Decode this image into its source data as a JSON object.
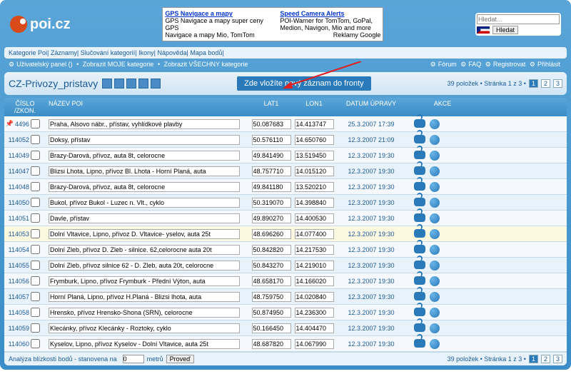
{
  "site": {
    "name": "poi.cz"
  },
  "ads": {
    "col1": {
      "title": "GPS Navigace a mapy",
      "line1": "GPS Navigace a mapy super ceny GPS",
      "line2": "Navigace a mapy Mio, TomTom"
    },
    "col2": {
      "title": "Speed Camera Alerts",
      "line1": "POI-Warner for TomTom, GoPal,",
      "line2": "Medion, Navigon, Mio and more",
      "foot": "Reklamy Google"
    }
  },
  "search": {
    "placeholder": "Hledat...",
    "button": "Hledat"
  },
  "nav": {
    "items": [
      "Kategorie Poi",
      "Záznamy",
      "Slučování kategorií",
      "Ikony",
      "Nápověda",
      "Mapa bodů"
    ]
  },
  "subnav": {
    "left": [
      "Uživatelský panel ()",
      "Zobrazit MOJE kategorie",
      "Zobrazit VŠECHNY kategorie"
    ],
    "right": [
      "Fórum",
      "FAQ",
      "Registrovat",
      "Přihlásit"
    ]
  },
  "title": "CZ-Privozy_pristavy",
  "banner": "Zde vložíte nový záznam do fronty",
  "pager": {
    "text": "39 položek • Stránka 1 z 3 •",
    "pages": [
      "1",
      "2",
      "3"
    ]
  },
  "columns": {
    "c1": "ČÍSLO /ZKON.",
    "c2": "NÁZEV POI",
    "c3": "LAT1",
    "c4": "LON1",
    "c5": "DATUM ÚPRAVY",
    "c6": "AKCE"
  },
  "rows": [
    {
      "id": "4496",
      "pin": true,
      "name": "Praha, Alsovo nábr., přístav, vyhlídkové plavby",
      "lat": "50.087683",
      "lon": "14.413747",
      "date": "25.3.2007 17:39"
    },
    {
      "id": "114052",
      "name": "Doksy, přístav",
      "lat": "50.576110",
      "lon": "14.650760",
      "date": "12.3.2007 21:09"
    },
    {
      "id": "114049",
      "name": "Brazy-Darová, přívoz, auta 8t, celorocne",
      "lat": "49.841490",
      "lon": "13.519450",
      "date": "12.3.2007 19:30"
    },
    {
      "id": "114047",
      "name": "Blizsi Lhota, Lipno, přívoz Bl. Lhota - Horní Planá, auta",
      "lat": "48.757710",
      "lon": "14.015120",
      "date": "12.3.2007 19:30"
    },
    {
      "id": "114048",
      "name": "Brazy-Darová, přívoz, auta 8t, celorocne",
      "lat": "49.841180",
      "lon": "13.520210",
      "date": "12.3.2007 19:30"
    },
    {
      "id": "114050",
      "name": "Bukol, přívoz Bukol - Luzec n. Vlt., cyklo",
      "lat": "50.319070",
      "lon": "14.398840",
      "date": "12.3.2007 19:30"
    },
    {
      "id": "114051",
      "name": "Davle, přístav",
      "lat": "49.890270",
      "lon": "14.400530",
      "date": "12.3.2007 19:30"
    },
    {
      "id": "114053",
      "hl": true,
      "name": "Dolní Vltavice, Lipno, přívoz D. Vltavice- yselov, auta 25t",
      "lat": "48.696260",
      "lon": "14.077400",
      "date": "12.3.2007 19:30"
    },
    {
      "id": "114054",
      "name": "Dolní Zleb, přívoz D. Zleb - silnice. 62,celorocne auta 20t",
      "lat": "50.842820",
      "lon": "14.217530",
      "date": "12.3.2007 19:30"
    },
    {
      "id": "114055",
      "name": "Dolní Zleb, přívoz silnice 62 - D. Zleb, auta 20t, celorocne",
      "lat": "50.843270",
      "lon": "14.219010",
      "date": "12.3.2007 19:30"
    },
    {
      "id": "114056",
      "name": "Frymburk, Lipno, přívoz Frymburk - Přední Výton, auta",
      "lat": "48.658170",
      "lon": "14.166020",
      "date": "12.3.2007 19:30"
    },
    {
      "id": "114057",
      "name": "Horní Planá, Lipno, přívoz H.Planá - Blizsi lhota, auta",
      "lat": "48.759750",
      "lon": "14.020840",
      "date": "12.3.2007 19:30"
    },
    {
      "id": "114058",
      "name": "Hrensko, přívoz Hrensko-Shona (SRN), celorocne",
      "lat": "50.874950",
      "lon": "14.236300",
      "date": "12.3.2007 19:30"
    },
    {
      "id": "114059",
      "name": "Klecánky, přívoz Klecánky - Roztoky, cyklo",
      "lat": "50.166450",
      "lon": "14.404470",
      "date": "12.3.2007 19:30"
    },
    {
      "id": "114060",
      "name": "Kyselov, Lipno, přívoz Kyselov - Dolní Vltavice, auta 25t",
      "lat": "48.687820",
      "lon": "14.067990",
      "date": "12.3.2007 19:30"
    }
  ],
  "footer": {
    "label": "Analýza blízkosti bodů - stanovena na",
    "val": "0",
    "unit": "metrů",
    "btn": "Proveď"
  }
}
